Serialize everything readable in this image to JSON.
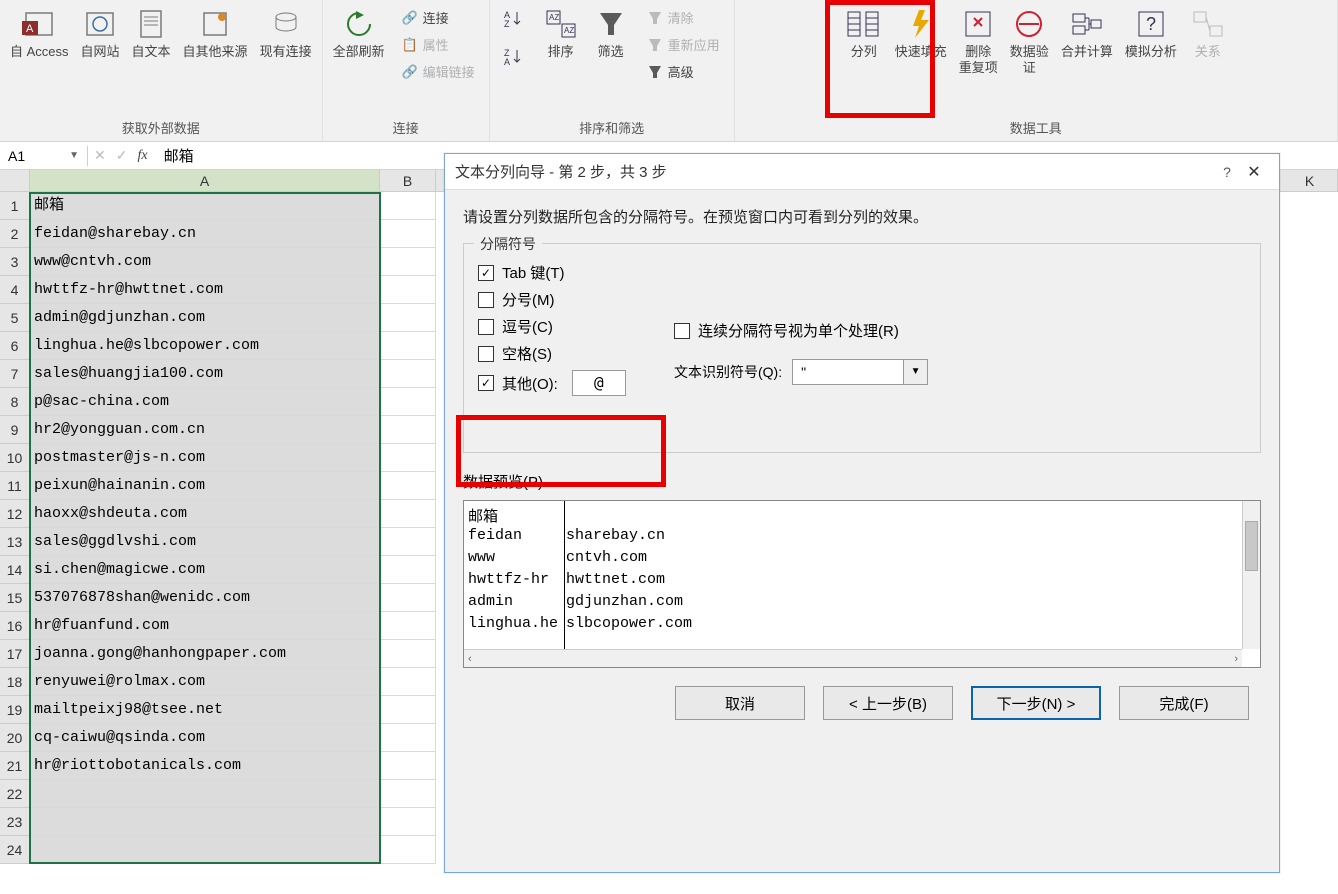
{
  "ribbon": {
    "groups": {
      "external": {
        "label": "获取外部数据",
        "access": "自 Access",
        "web": "自网站",
        "text": "自文本",
        "other": "自其他来源",
        "existing": "现有连接"
      },
      "conn": {
        "label": "连接",
        "refresh": "全部刷新",
        "connections": "连接",
        "properties": "属性",
        "editlinks": "编辑链接"
      },
      "sortfilter": {
        "label": "排序和筛选",
        "sort": "排序",
        "filter": "筛选",
        "clear": "清除",
        "reapply": "重新应用",
        "advanced": "高级"
      },
      "datatools": {
        "label": "数据工具",
        "texttocolumns": "分列",
        "flashfill": "快速填充",
        "removedup": "删除\n重复项",
        "validation": "数据验\n证",
        "consolidate": "合并计算",
        "whatif": "模拟分析",
        "relations": "关系"
      }
    }
  },
  "namebox": "A1",
  "formula": "邮箱",
  "columns": [
    "A",
    "B",
    "K"
  ],
  "rows": [
    "邮箱",
    "feidan@sharebay.cn",
    "www@cntvh.com",
    "hwttfz-hr@hwttnet.com",
    "admin@gdjunzhan.com",
    "linghua.he@slbcopower.com",
    "sales@huangjia100.com",
    "p@sac-china.com",
    "hr2@yongguan.com.cn",
    "postmaster@js-n.com",
    "peixun@hainanin.com",
    "haoxx@shdeuta.com",
    "sales@ggdlvshi.com",
    "si.chen@magicwe.com",
    "537076878shan@wenidc.com",
    "hr@fuanfund.com",
    "joanna.gong@hanhongpaper.com",
    "renyuwei@rolmax.com",
    "mailtpeixj98@tsee.net",
    "cq-caiwu@qsinda.com",
    "hr@riottobotanicals.com",
    "",
    "",
    ""
  ],
  "dialog": {
    "title": "文本分列向导 - 第 2 步，共 3 步",
    "instruction": "请设置分列数据所包含的分隔符号。在预览窗口内可看到分列的效果。",
    "delimiters_legend": "分隔符号",
    "tab": "Tab 键(T)",
    "semicolon": "分号(M)",
    "comma": "逗号(C)",
    "space": "空格(S)",
    "other": "其他(O):",
    "other_value": "@",
    "consecutive": "连续分隔符号视为单个处理(R)",
    "textqual_label": "文本识别符号(Q):",
    "textqual_value": "\"",
    "preview_label": "数据预览(P)",
    "preview_rows": [
      {
        "c1": "邮箱",
        "c2": ""
      },
      {
        "c1": "feidan",
        "c2": "sharebay.cn"
      },
      {
        "c1": "www",
        "c2": "cntvh.com"
      },
      {
        "c1": "hwttfz-hr",
        "c2": "hwttnet.com"
      },
      {
        "c1": "admin",
        "c2": "gdjunzhan.com"
      },
      {
        "c1": "linghua.he",
        "c2": "slbcopower.com"
      }
    ],
    "btn_cancel": "取消",
    "btn_back": "< 上一步(B)",
    "btn_next": "下一步(N) >",
    "btn_finish": "完成(F)"
  }
}
